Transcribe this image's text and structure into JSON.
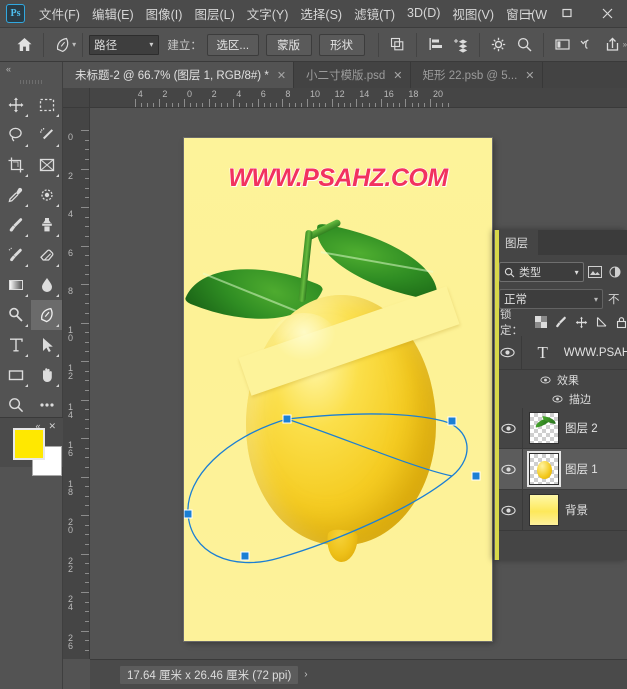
{
  "app": {
    "logo_text": "Ps",
    "menu": [
      {
        "label": "文件(F)",
        "name": "menu-file"
      },
      {
        "label": "编辑(E)",
        "name": "menu-edit"
      },
      {
        "label": "图像(I)",
        "name": "menu-image"
      },
      {
        "label": "图层(L)",
        "name": "menu-layer"
      },
      {
        "label": "文字(Y)",
        "name": "menu-type"
      },
      {
        "label": "选择(S)",
        "name": "menu-select"
      },
      {
        "label": "滤镜(T)",
        "name": "menu-filter"
      },
      {
        "label": "3D(D)",
        "name": "menu-3d"
      },
      {
        "label": "视图(V)",
        "name": "menu-view"
      },
      {
        "label": "窗口(W",
        "name": "menu-window"
      }
    ],
    "window_controls": {
      "minimize": "minimize-icon",
      "maximize": "maximize-icon",
      "close": "close-icon"
    }
  },
  "options_bar": {
    "home_icon": "home-icon",
    "tool_icon": "pen-tool-icon",
    "mode_value": "路径",
    "create_label": "建立：",
    "buttons": [
      {
        "label": "选区...",
        "name": "make-selection-button"
      },
      {
        "label": "蒙版",
        "name": "make-mask-button"
      },
      {
        "label": "形状",
        "name": "make-shape-button"
      }
    ],
    "right_icons": [
      "path-operations-icon",
      "path-alignment-icon",
      "path-arrangement-icon",
      "gear-icon",
      "search-icon",
      "workspace-icon",
      "history-icon",
      "share-icon"
    ]
  },
  "tabs": [
    {
      "label": "未标题-2 @ 66.7% (图层 1, RGB/8#) *",
      "active": true,
      "name": "tab-untitled-2"
    },
    {
      "label": "小二寸模版.psd",
      "active": false,
      "name": "tab-xiaoercun"
    },
    {
      "label": "矩形 22.psb @ 5...",
      "active": false,
      "name": "tab-rect-22"
    }
  ],
  "toolbar": {
    "collapse_glyph": "«",
    "tools": [
      {
        "name": "move-tool",
        "icon": "move-icon",
        "selected": false
      },
      {
        "name": "marquee-tool",
        "icon": "rectangular-marquee-icon",
        "selected": false
      },
      {
        "name": "lasso-tool",
        "icon": "lasso-icon",
        "selected": false
      },
      {
        "name": "quick-selection-tool",
        "icon": "magic-wand-icon",
        "selected": false
      },
      {
        "name": "crop-tool",
        "icon": "crop-icon",
        "selected": false
      },
      {
        "name": "slice-tool",
        "icon": "frame-icon",
        "selected": false
      },
      {
        "name": "eyedropper-tool",
        "icon": "eyedropper-icon",
        "selected": false
      },
      {
        "name": "patch-tool",
        "icon": "spot-healing-icon",
        "selected": false
      },
      {
        "name": "brush-tool",
        "icon": "brush-icon",
        "selected": false
      },
      {
        "name": "clone-stamp-tool",
        "icon": "clone-stamp-icon",
        "selected": false
      },
      {
        "name": "history-brush-tool",
        "icon": "history-brush-icon",
        "selected": false
      },
      {
        "name": "eraser-tool",
        "icon": "eraser-icon",
        "selected": false
      },
      {
        "name": "gradient-tool",
        "icon": "gradient-icon",
        "selected": false
      },
      {
        "name": "blur-tool",
        "icon": "blur-drop-icon",
        "selected": false
      },
      {
        "name": "dodge-tool",
        "icon": "dodge-icon",
        "selected": false
      },
      {
        "name": "pen-tool",
        "icon": "pen-icon",
        "selected": true
      },
      {
        "name": "type-tool",
        "icon": "type-t-icon",
        "selected": false
      },
      {
        "name": "path-selection-tool",
        "icon": "path-arrow-icon",
        "selected": false
      },
      {
        "name": "shape-tool",
        "icon": "rectangle-shape-icon",
        "selected": false
      },
      {
        "name": "hand-tool",
        "icon": "hand-icon",
        "selected": false
      },
      {
        "name": "zoom-tool",
        "icon": "zoom-magnifier-icon",
        "selected": false
      },
      {
        "name": "edit-toolbar",
        "icon": "ellipsis-icon",
        "selected": false
      }
    ],
    "foreground_color": "#ffe800",
    "background_color": "#ffffff",
    "swap_icon": "swap-colors-icon"
  },
  "mini_panel": {
    "collapse_glyph": "«",
    "close_glyph": "✕",
    "menu_glyph": "≡"
  },
  "rulers": {
    "unit": "厘米",
    "horizontal_labels": [
      "4",
      "2",
      "0",
      "2",
      "4",
      "6",
      "8",
      "10",
      "12",
      "14",
      "16",
      "18",
      "20"
    ],
    "vertical_labels": [
      "0",
      "2",
      "4",
      "6",
      "8",
      "10",
      "12",
      "14",
      "16",
      "18",
      "20",
      "22",
      "24",
      "26"
    ]
  },
  "canvas": {
    "background_color": "#fdf39a",
    "watermark_text": "WWW.PSAHZ.COM",
    "watermark_color": "#f2325f",
    "watermark_stroke": "#ffffff",
    "path_color": "#1b7fd4",
    "subject": "lemon-with-leaves"
  },
  "status_bar": {
    "text": "17.64 厘米 x 26.46 厘米 (72 ppi)",
    "arrow": "›"
  },
  "layers_panel": {
    "tab_label": "图层",
    "filter": {
      "search_icon": "search-icon",
      "type_value": "类型",
      "chevron": "˅",
      "icons": [
        "pixel-filter-icon",
        "adjustment-filter-icon"
      ]
    },
    "blend_mode": "正常",
    "opacity_label": "不",
    "lock_label": "锁定：",
    "lock_icons": [
      "lock-transparency-icon",
      "lock-image-icon",
      "lock-position-icon",
      "lock-artboard-icon",
      "lock-all-icon"
    ],
    "layers": [
      {
        "name": "WWW.PSAH",
        "type": "text",
        "thumb": "T",
        "visible": true,
        "selected": false,
        "effects": [
          {
            "label": "效果",
            "visible": true,
            "name": "layer-effects-group"
          },
          {
            "label": "描边",
            "visible": true,
            "name": "layer-effect-stroke"
          }
        ]
      },
      {
        "name": "图层 2",
        "type": "image",
        "thumb": "leaf",
        "visible": true,
        "selected": false,
        "effects": []
      },
      {
        "name": "图层 1",
        "type": "image",
        "thumb": "lemon",
        "visible": true,
        "selected": true,
        "effects": []
      },
      {
        "name": "背景",
        "type": "background",
        "thumb": "solid-yellow",
        "visible": true,
        "selected": false,
        "effects": []
      }
    ]
  }
}
